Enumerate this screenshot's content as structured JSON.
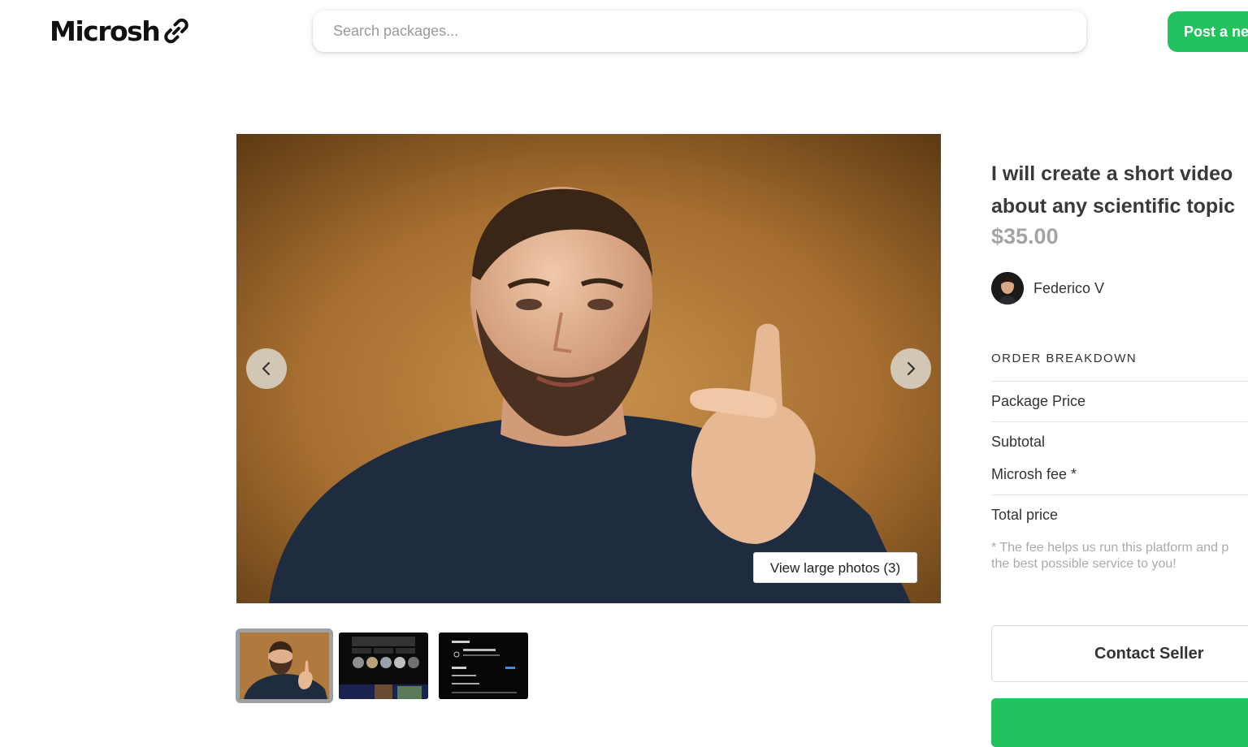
{
  "header": {
    "logo_text": "Microsh",
    "search_placeholder": "Search packages...",
    "post_button": "Post a new"
  },
  "carousel": {
    "view_photos_label": "View large photos (3)",
    "photo_count": 3,
    "active_index": 0
  },
  "package": {
    "title_line1": "I will create a short video",
    "title_line2": "about any scientific topic",
    "price": "$35.00"
  },
  "seller": {
    "name": "Federico V"
  },
  "order_breakdown": {
    "heading": "ORDER BREAKDOWN",
    "package_price_label": "Package Price",
    "subtotal_label": "Subtotal",
    "fee_label": "Microsh fee *",
    "total_label": "Total price",
    "note_line1": "* The fee helps us run this platform and p",
    "note_line2": "the best possible service to you!"
  },
  "actions": {
    "contact_seller": "Contact Seller"
  },
  "colors": {
    "brand_green": "#22c35e",
    "price_gray": "#a4a4a4"
  }
}
